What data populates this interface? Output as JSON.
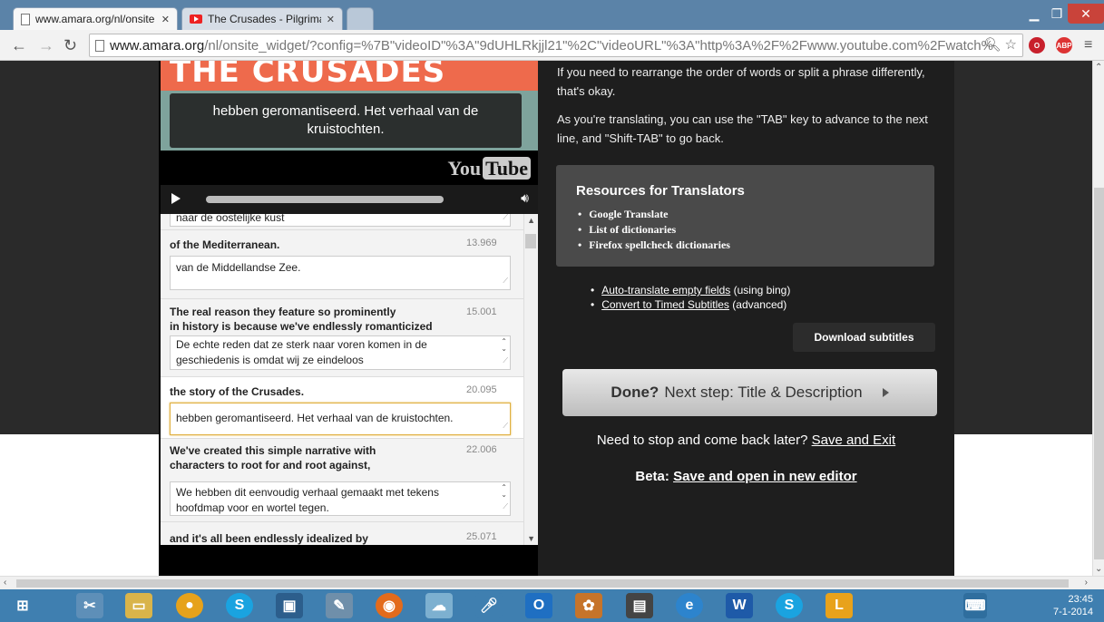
{
  "browser": {
    "tabs": [
      {
        "label": "www.amara.org/nl/onsite",
        "active": true
      },
      {
        "label": "The Crusades - Pilgrimage",
        "active": false
      }
    ],
    "url_host": "www.amara.org",
    "url_path": "/nl/onsite_widget/?config=%7B\"videoID\"%3A\"9dUHLRkjjl21\"%2C\"videoURL\"%3A\"http%3A%2F%2Fwww.youtube.com%2Fwatch%",
    "ext_abp": "ABP"
  },
  "video": {
    "banner_text": "THE CRUSADES",
    "subtitle": "hebben geromantiseerd. Het verhaal van de kruistochten.",
    "yt_you": "You",
    "yt_tube": "Tube"
  },
  "subtitles": {
    "partial_field": "naar de oostelijke kust",
    "rows": [
      {
        "original": "of the Mediterranean.",
        "time": "13.969",
        "translation": "van de Middellandse Zee."
      },
      {
        "original": "The real reason they feature so prominently\nin history is because we've endlessly romanticized",
        "time": "15.001",
        "translation": "De echte reden dat ze sterk naar voren komen in de geschiedenis is omdat wij ze eindeloos"
      },
      {
        "original": "the story of the Crusades.",
        "time": "20.095",
        "translation": "hebben geromantiseerd. Het verhaal van de kruistochten."
      },
      {
        "original": "We've created this simple narrative with\ncharacters to root for and root against,",
        "time": "22.006",
        "translation": "We hebben dit eenvoudig verhaal gemaakt met tekens hoofdmap voor en wortel tegen."
      },
      {
        "original": "and it's all been endlessly idealized by",
        "time": "25.071",
        "translation": ""
      }
    ]
  },
  "instructions": {
    "p1": "If you need to rearrange the order of words or split a phrase differently, that's okay.",
    "p2": "As you're translating, you can use the \"TAB\" key to advance to the next line, and \"Shift-TAB\" to go back."
  },
  "resources": {
    "title": "Resources for Translators",
    "items": [
      "Google Translate",
      "List of dictionaries",
      "Firefox spellcheck dictionaries"
    ]
  },
  "tools": {
    "auto_translate_link": "Auto-translate empty fields",
    "auto_translate_note": " (using bing)",
    "convert_link": "Convert to Timed Subtitles",
    "convert_note": " (advanced)"
  },
  "buttons": {
    "download": "Download subtitles",
    "done_bold": "Done?",
    "done_rest": "Next step: Title & Description"
  },
  "footer": {
    "save_prompt": "Need to stop and come back later?",
    "save_exit": "Save and Exit",
    "beta_label": "Beta:",
    "beta_link": "Save and open in new editor"
  },
  "taskbar": {
    "time": "23:45",
    "date": "7-1-2014"
  },
  "colors": {
    "banner": "#ee6a4c",
    "tab_bar": "#5b83a8",
    "taskbar": "#3f7fb0"
  }
}
